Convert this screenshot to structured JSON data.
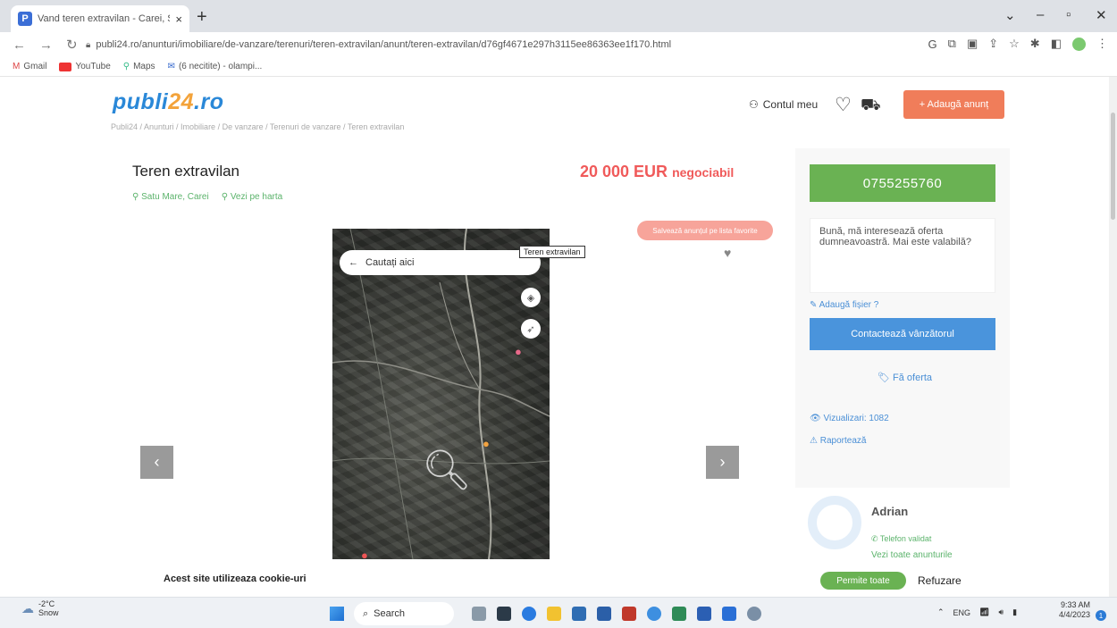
{
  "browser": {
    "tab_title": "Vand teren extravilan - Carei, S...",
    "tab_close": "×",
    "new_tab": "+",
    "url": "publi24.ro/anunturi/imobiliare/de-vanzare/terenuri/teren-extravilan/anunt/teren-extravilan/d76gf4671e297h3115ee86363ee1f170.html",
    "bookmarks": [
      "Gmail",
      "YouTube",
      "Maps",
      "(6 necitite) - olampi..."
    ]
  },
  "site": {
    "logo_part1": "publi",
    "logo_accent": "24",
    "logo_part2": ".ro",
    "breadcrumb": "Publi24 / Anunturi / Imobiliare / De vanzare / Terenuri de vanzare / Teren extravilan",
    "account_label": "Contul meu",
    "add_listing_label": "+ Adaugă anunț"
  },
  "listing": {
    "title": "Teren extravilan",
    "location": "Satu Mare, Carei",
    "map_link": "Vezi pe harta",
    "price": "20 000 EUR",
    "negotiable": "negociabil",
    "save_search": "Salvează anunțul pe lista favorite"
  },
  "gallery": {
    "search_placeholder": "Cautați aici",
    "tooltip": "Teren extravilan",
    "prev": "‹",
    "next": "›"
  },
  "sidebar": {
    "phone": "0755255760",
    "message": "Bună, mă interesează oferta dumneavoastră. Mai este valabilă?",
    "attach_file": "Adaugă fișier ?",
    "contact_seller": "Contactează vânzătorul",
    "make_offer": "Fă oferta",
    "views": "Vizualizari: 1082",
    "report": "Raportează"
  },
  "seller": {
    "name": "Adrian",
    "phone_label": "Telefon validat",
    "all_listings": "Vezi toate anunturile"
  },
  "cookie": {
    "text": "Acest site utilizeaza cookie-uri",
    "allow": "Permite toate",
    "refuse": "Refuzare"
  },
  "taskbar": {
    "temp": "-2°C",
    "weather": "Snow",
    "search": "Search",
    "lang": "ENG",
    "time": "9:33 AM",
    "date": "4/4/2023",
    "notif_count": "1"
  }
}
